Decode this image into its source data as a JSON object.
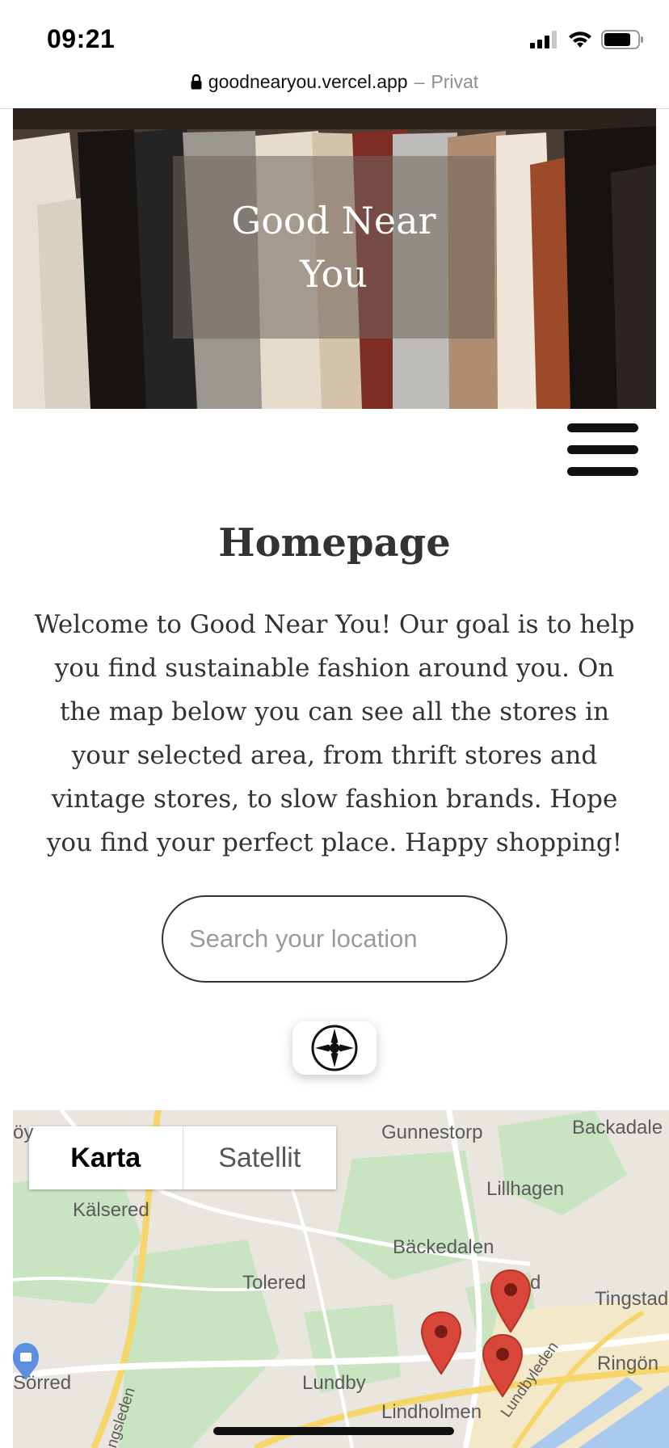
{
  "status_bar": {
    "time": "09:21",
    "icons": [
      "signal-icon",
      "wifi-icon",
      "battery-icon"
    ]
  },
  "browser": {
    "url": "goodnearyou.vercel.app",
    "separator": "–",
    "mode_label": "Privat",
    "lock_icon": "lock-icon"
  },
  "hero": {
    "title": "Good Near You"
  },
  "menu": {
    "icon": "hamburger-menu-icon"
  },
  "main": {
    "title": "Homepage",
    "intro": "Welcome to Good Near You! Our goal is to help you find sustainable fashion around you. On the map below you can see all the stores in your selected area, from thrift stores and vintage stores, to slow fashion brands. Hope you find your perfect place. Happy shopping!"
  },
  "search": {
    "value": "",
    "placeholder": "Search your location"
  },
  "locate_button": {
    "icon": "compass-icon"
  },
  "map": {
    "type_control": {
      "options": [
        "Karta",
        "Satellit"
      ],
      "selected": "Karta"
    },
    "places": {
      "gunnestorp": "Gunnestorp",
      "backadalen_top": "Backadale",
      "kalsered": "Kälsered",
      "lillhagen": "Lillhagen",
      "backedalen": "Bäckedalen",
      "tolered": "Tolered",
      "tingstad": "Tingstad",
      "ringon": "Ringön",
      "sorred": "Sörred",
      "lundby": "Lundby",
      "lindholmen": "Lindholmen",
      "lundbyleden": "Lundbyleden",
      "angsleden": "ngsleden",
      "oy": "öy",
      "d_fragment": "d"
    },
    "store_markers": 3,
    "colors": {
      "marker": "#d9463a",
      "marker_dot": "#7a1c14",
      "park": "#c8e4c1",
      "road": "#ffffff",
      "highway": "#f6d56a",
      "water": "#a9c9ee",
      "shopping_pin": "#5b8fe0"
    }
  }
}
